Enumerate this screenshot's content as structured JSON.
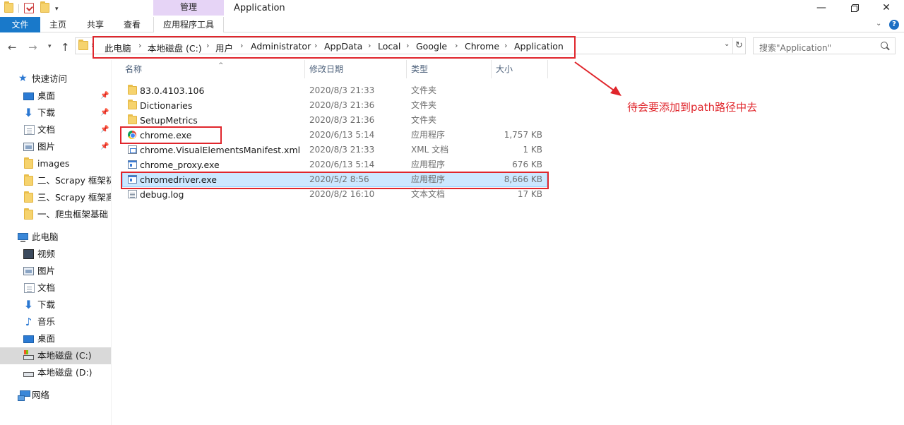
{
  "window": {
    "title": "Application",
    "context_group": "管理",
    "min_glyph": "—",
    "close_glyph": "✕"
  },
  "ribbon": {
    "tabs": [
      {
        "label": "文件"
      },
      {
        "label": "主页"
      },
      {
        "label": "共享"
      },
      {
        "label": "查看"
      },
      {
        "label": "应用程序工具"
      }
    ],
    "help_glyph": "?"
  },
  "address": {
    "breadcrumb": [
      "此电脑",
      "本地磁盘 (C:)",
      "用户",
      "Administrator",
      "AppData",
      "Local",
      "Google",
      "Chrome",
      "Application"
    ],
    "separator": "›"
  },
  "search": {
    "placeholder": "搜索\"Application\""
  },
  "sidebar": {
    "quick_access": {
      "label": "快速访问",
      "icon": "star-icon"
    },
    "quick_items": [
      {
        "label": "桌面",
        "icon": "desktop-icon",
        "pinned": true
      },
      {
        "label": "下载",
        "icon": "download-icon",
        "pinned": true
      },
      {
        "label": "文档",
        "icon": "document-icon",
        "pinned": true
      },
      {
        "label": "图片",
        "icon": "picture-icon",
        "pinned": true
      },
      {
        "label": "images",
        "icon": "folder-icon",
        "pinned": false
      },
      {
        "label": "二、Scrapy 框架初",
        "icon": "folder-icon",
        "pinned": false
      },
      {
        "label": "三、Scrapy 框架高",
        "icon": "folder-icon",
        "pinned": false
      },
      {
        "label": "一、爬虫框架基础",
        "icon": "folder-icon",
        "pinned": false
      }
    ],
    "this_pc": {
      "label": "此电脑",
      "icon": "computer-icon"
    },
    "pc_items": [
      {
        "label": "视频",
        "icon": "video-icon"
      },
      {
        "label": "图片",
        "icon": "picture-icon"
      },
      {
        "label": "文档",
        "icon": "document-icon"
      },
      {
        "label": "下载",
        "icon": "download-icon"
      },
      {
        "label": "音乐",
        "icon": "music-icon"
      },
      {
        "label": "桌面",
        "icon": "desktop-icon"
      },
      {
        "label": "本地磁盘 (C:)",
        "icon": "drive-c-icon",
        "selected": true
      },
      {
        "label": "本地磁盘 (D:)",
        "icon": "drive-icon"
      }
    ],
    "network": {
      "label": "网络",
      "icon": "network-icon"
    }
  },
  "columns": {
    "name": "名称",
    "date": "修改日期",
    "type": "类型",
    "size": "大小"
  },
  "files": [
    {
      "name": "83.0.4103.106",
      "date": "2020/8/3 21:33",
      "type": "文件夹",
      "size": "",
      "icon": "folder-icon"
    },
    {
      "name": "Dictionaries",
      "date": "2020/8/3 21:36",
      "type": "文件夹",
      "size": "",
      "icon": "folder-icon"
    },
    {
      "name": "SetupMetrics",
      "date": "2020/8/3 21:36",
      "type": "文件夹",
      "size": "",
      "icon": "folder-icon"
    },
    {
      "name": "chrome.exe",
      "date": "2020/6/13 5:14",
      "type": "应用程序",
      "size": "1,757 KB",
      "icon": "chrome-icon"
    },
    {
      "name": "chrome.VisualElementsManifest.xml",
      "date": "2020/8/3 21:33",
      "type": "XML 文档",
      "size": "1 KB",
      "icon": "xml-file-icon"
    },
    {
      "name": "chrome_proxy.exe",
      "date": "2020/6/13 5:14",
      "type": "应用程序",
      "size": "676 KB",
      "icon": "exe-icon"
    },
    {
      "name": "chromedriver.exe",
      "date": "2020/5/2 8:56",
      "type": "应用程序",
      "size": "8,666 KB",
      "icon": "exe-icon",
      "selected": true
    },
    {
      "name": "debug.log",
      "date": "2020/8/2 16:10",
      "type": "文本文档",
      "size": "17 KB",
      "icon": "log-file-icon"
    }
  ],
  "annotation": {
    "text": "待会要添加到path路径中去",
    "color": "#e0262c"
  },
  "colors": {
    "file_tab": "#1979ca",
    "context_tab": "#e6d4f6",
    "selection": "#cce8ff",
    "highlight": "#e0262c"
  }
}
